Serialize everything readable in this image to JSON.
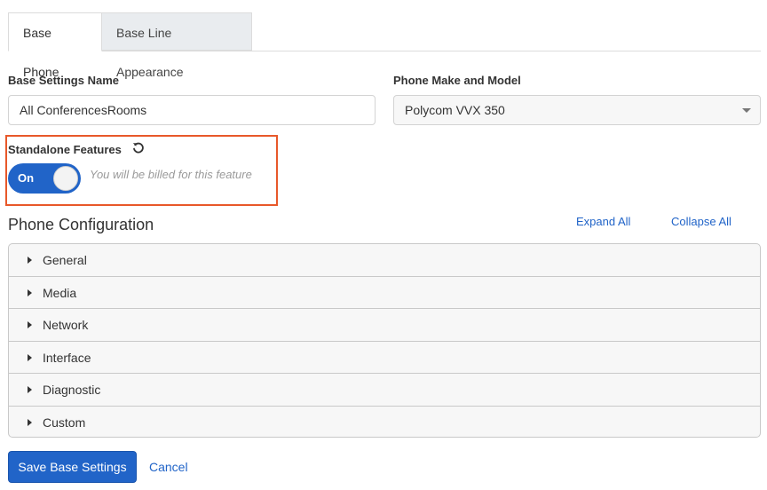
{
  "tabs": [
    {
      "label": "Base Phone",
      "active": true
    },
    {
      "label": "Base Line Appearance",
      "active": false
    }
  ],
  "base_settings_name": {
    "label": "Base Settings Name",
    "value": "All ConferencesRooms"
  },
  "phone_model": {
    "label": "Phone Make and Model",
    "value": "Polycom VVX 350"
  },
  "standalone": {
    "label": "Standalone Features",
    "toggle_label": "On",
    "enabled": true,
    "note": "You will be billed for this feature",
    "reset_icon": "reset-icon"
  },
  "phone_config": {
    "title": "Phone Configuration",
    "expand_all": "Expand All",
    "collapse_all": "Collapse All",
    "sections": [
      "General",
      "Media",
      "Network",
      "Interface",
      "Diagnostic",
      "Custom"
    ]
  },
  "actions": {
    "save": "Save Base Settings",
    "cancel": "Cancel"
  },
  "colors": {
    "accent": "#2164c8",
    "highlight": "#e8582a"
  }
}
